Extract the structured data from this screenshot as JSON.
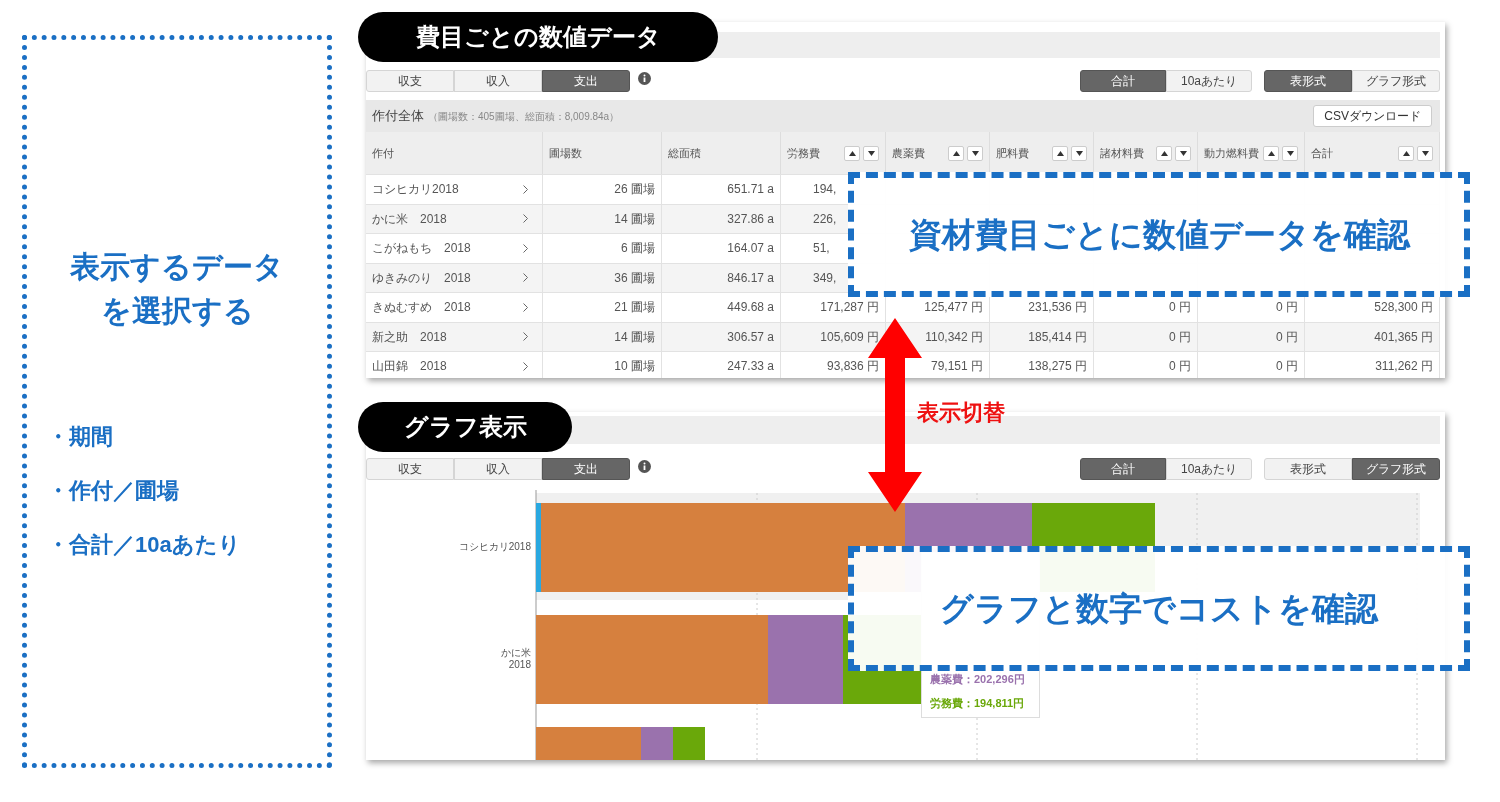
{
  "side_panel": {
    "title_lines": [
      "表示するデータ",
      "を選択する"
    ],
    "bullets": [
      "・期間",
      "・作付／圃場",
      "・合計／10aあたり"
    ]
  },
  "table_view": {
    "label": "費目ごとの数値データ",
    "type_tabs": [
      {
        "label": "収支",
        "selected": false
      },
      {
        "label": "収入",
        "selected": false
      },
      {
        "label": "支出",
        "selected": true
      }
    ],
    "unit_toggle": [
      {
        "label": "合計",
        "selected": true
      },
      {
        "label": "10aあたり",
        "selected": false
      }
    ],
    "format_toggle": [
      {
        "label": "表形式",
        "selected": true
      },
      {
        "label": "グラフ形式",
        "selected": false
      }
    ],
    "summary_title": "作付全体",
    "summary_note": "（圃場数：405圃場、総面積：8,009.84a）",
    "csv_button": "CSVダウンロード",
    "columns": [
      {
        "label": "作付",
        "sortable": false
      },
      {
        "label": "圃場数",
        "sortable": false
      },
      {
        "label": "総面積",
        "sortable": false
      },
      {
        "label": "労務費",
        "sortable": true
      },
      {
        "label": "農薬費",
        "sortable": true
      },
      {
        "label": "肥料費",
        "sortable": true
      },
      {
        "label": "諸材料費",
        "sortable": true
      },
      {
        "label": "動力燃料費",
        "sortable": true
      },
      {
        "label": "合計",
        "sortable": true
      }
    ],
    "rows": [
      {
        "cells": [
          "コシヒカリ2018",
          "26 圃場",
          "651.71 a",
          "194,",
          null,
          null,
          null,
          null,
          null
        ]
      },
      {
        "cells": [
          "かに米　2018",
          "14 圃場",
          "327.86 a",
          "226,",
          null,
          null,
          null,
          null,
          null
        ]
      },
      {
        "cells": [
          "こがねもち　2018",
          "6 圃場",
          "164.07 a",
          "51,",
          null,
          null,
          null,
          null,
          null
        ]
      },
      {
        "cells": [
          "ゆきみのり　2018",
          "36 圃場",
          "846.17 a",
          "349,",
          null,
          null,
          null,
          null,
          null
        ]
      },
      {
        "cells": [
          "きぬむすめ　2018",
          "21 圃場",
          "449.68 a",
          "171,287 円",
          "125,477 円",
          "231,536 円",
          "0 円",
          "0 円",
          "528,300 円"
        ]
      },
      {
        "cells": [
          "新之助　2018",
          "14 圃場",
          "306.57 a",
          "105,609 円",
          "110,342 円",
          "185,414 円",
          "0 円",
          "0 円",
          "401,365 円"
        ]
      },
      {
        "cells": [
          "山田錦　2018",
          "10 圃場",
          "247.33 a",
          "93,836 円",
          "79,151 円",
          "138,275 円",
          "0 円",
          "0 円",
          "311,262 円"
        ]
      }
    ],
    "callout": "資材費目ごとに数値データを確認"
  },
  "switch_label": "表示切替",
  "graph_view": {
    "label": "グラフ表示",
    "type_tabs": [
      {
        "label": "収支",
        "selected": false
      },
      {
        "label": "収入",
        "selected": false
      },
      {
        "label": "支出",
        "selected": true
      }
    ],
    "unit_toggle": [
      {
        "label": "合計",
        "selected": true
      },
      {
        "label": "10aあたり",
        "selected": false
      }
    ],
    "format_toggle": [
      {
        "label": "表形式",
        "selected": false
      },
      {
        "label": "グラフ形式",
        "selected": true
      }
    ],
    "category_labels": [
      [
        "コシヒカリ2018"
      ],
      [
        "かに米",
        "2018"
      ]
    ],
    "tooltip": {
      "lines": [
        {
          "text": "農薬費：202,296円",
          "color": "#9a72ad"
        },
        {
          "text": "労務費：194,811円",
          "color": "#6aa80a"
        }
      ]
    },
    "callout": "グラフと数字でコストを確認"
  }
}
